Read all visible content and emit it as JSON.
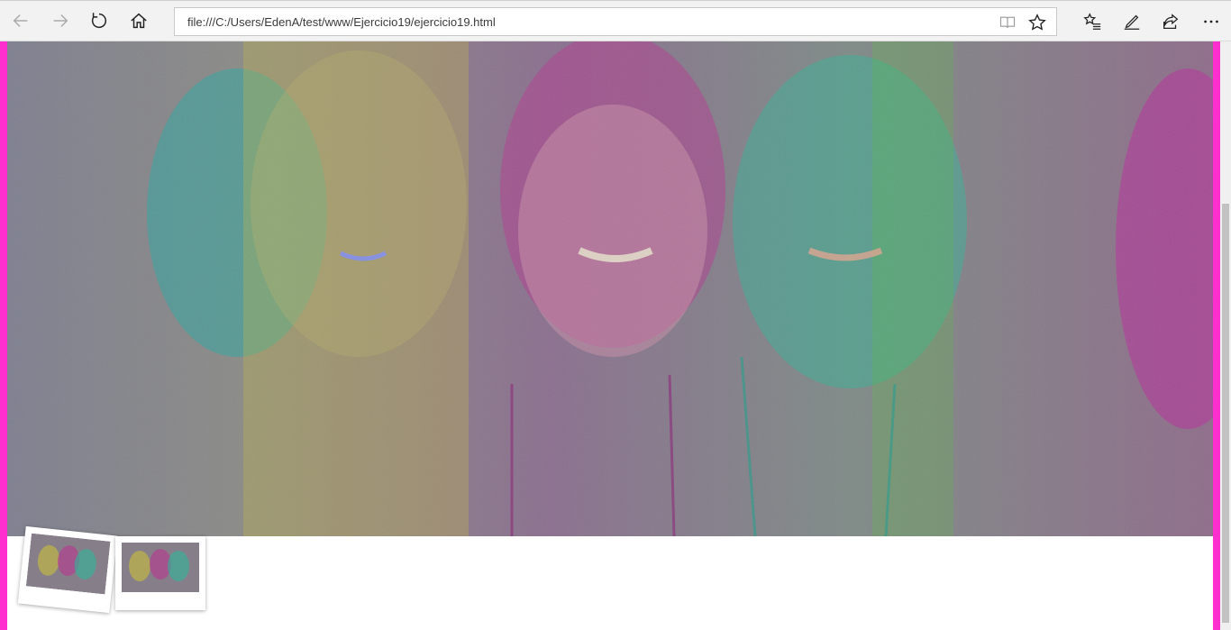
{
  "browser": {
    "url": "file:///C:/Users/EdenA/test/www/Ejercicio19/ejercicio19.html",
    "icons": {
      "back": "back-arrow-icon",
      "forward": "forward-arrow-icon",
      "refresh": "refresh-icon",
      "home": "home-icon",
      "reading_view": "book-icon",
      "favorite": "star-icon",
      "favorites_hub": "favorites-list-icon",
      "web_note": "pen-icon",
      "share": "share-icon",
      "more": "ellipsis-icon"
    }
  },
  "page": {
    "colors": {
      "side_border": "#ff2fcf",
      "background": "#ffffff"
    },
    "main_photo": {
      "description_icon": "photo-filtered-faces",
      "tints": [
        "#3aa6a0",
        "#d6c43a",
        "#b0409a",
        "#2fb59a",
        "#c23fa6"
      ]
    },
    "thumbnails": [
      {
        "icon": "photo-thumbnail",
        "rotated": true
      },
      {
        "icon": "photo-thumbnail",
        "rotated": false
      }
    ]
  }
}
